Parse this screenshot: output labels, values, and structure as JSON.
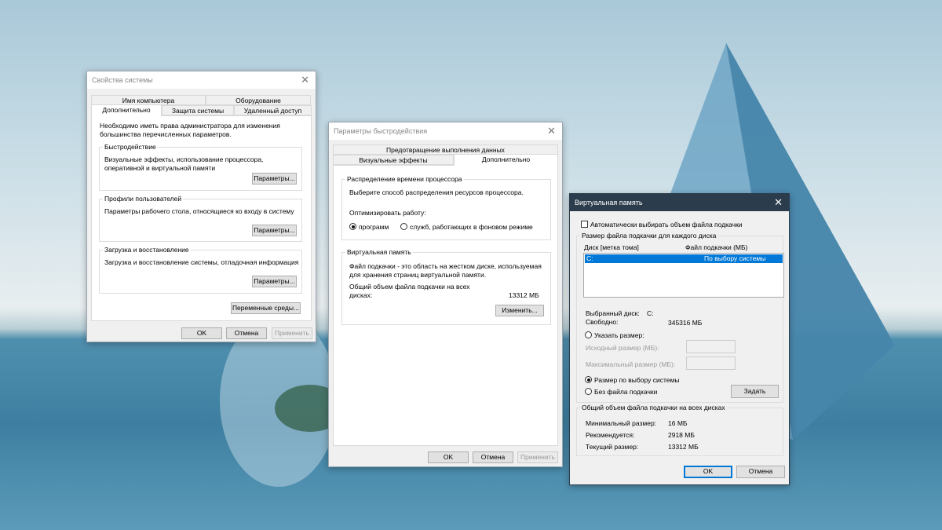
{
  "system_properties": {
    "title": "Свойства системы",
    "tabs_row1": [
      "Имя компьютера",
      "Оборудование"
    ],
    "tabs_row2": [
      "Дополнительно",
      "Защита системы",
      "Удаленный доступ"
    ],
    "admin_note": "Необходимо иметь права администратора для изменения большинства перечисленных параметров.",
    "performance": {
      "label": "Быстродействие",
      "desc": "Визуальные эффекты, использование процессора, оперативной и виртуальной памяти",
      "button": "Параметры..."
    },
    "profiles": {
      "label": "Профили пользователей",
      "desc": "Параметры рабочего стола, относящиеся ко входу в систему",
      "button": "Параметры..."
    },
    "startup": {
      "label": "Загрузка и восстановление",
      "desc": "Загрузка и восстановление системы, отладочная информация",
      "button": "Параметры..."
    },
    "env_button": "Переменные среды...",
    "ok": "OK",
    "cancel": "Отмена",
    "apply": "Применить"
  },
  "performance_options": {
    "title": "Параметры быстродействия",
    "tabs_row1": [
      "Предотвращение выполнения данных"
    ],
    "tabs_row2": [
      "Визуальные эффекты",
      "Дополнительно"
    ],
    "cpu": {
      "label": "Распределение времени процессора",
      "desc": "Выберите способ распределения ресурсов процессора.",
      "optimize": "Оптимизировать работу:",
      "opt_programs": "программ",
      "opt_services": "служб, работающих в фоновом режиме"
    },
    "vm": {
      "label": "Виртуальная память",
      "desc1": "Файл подкачки - это область на жестком диске, используемая",
      "desc2": "для хранения страниц виртуальной памяти.",
      "total1": "Общий объем файла подкачки на всех",
      "total2": "дисках:",
      "total_value": "13312 МБ",
      "button": "Изменить..."
    },
    "ok": "OK",
    "cancel": "Отмена",
    "apply": "Применить"
  },
  "virtual_memory": {
    "title": "Виртуальная память",
    "auto_label": "Автоматически выбирать объем файла подкачки",
    "auto_checked": false,
    "per_disk_label": "Размер файла подкачки для каждого диска",
    "col_disk": "Диск [метка тома]",
    "col_file": "Файл подкачки (МБ)",
    "rows": [
      {
        "disk": "C:",
        "size": "По выбору системы"
      }
    ],
    "selected_disk_label": "Выбранный диск:",
    "selected_disk": "C:",
    "free_label": "Свободно:",
    "free_value": "345316 МБ",
    "custom_size": "Указать размер:",
    "initial_size": "Исходный размер (МБ):",
    "max_size": "Максимальный размер (МБ):",
    "initial_value": "",
    "max_value": "",
    "system_managed": "Размер по выбору системы",
    "no_paging": "Без файла подкачки",
    "set_button": "Задать",
    "total_label": "Общий объем файла подкачки на всех дисках",
    "min_label": "Минимальный размер:",
    "min_value": "16 МБ",
    "rec_label": "Рекомендуется:",
    "rec_value": "2918 МБ",
    "cur_label": "Текущий размер:",
    "cur_value": "13312 МБ",
    "ok": "OK",
    "cancel": "Отмена",
    "accent": "#0078d7"
  }
}
